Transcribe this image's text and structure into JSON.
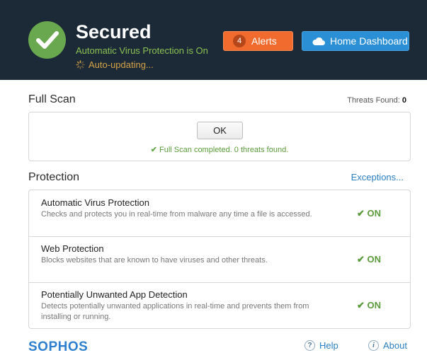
{
  "header": {
    "status_title": "Secured",
    "status_subtitle": "Automatic Virus Protection is On",
    "update_status": "Auto-updating...",
    "alerts": {
      "count": "4",
      "label": "Alerts"
    },
    "dashboard_label": "Home Dashboard"
  },
  "full_scan": {
    "title": "Full Scan",
    "threats_label": "Threats Found:",
    "threats_count": "0",
    "ok_label": "OK",
    "status_message": "Full Scan completed. 0 threats found."
  },
  "protection": {
    "title": "Protection",
    "exceptions_label": "Exceptions...",
    "items": [
      {
        "name": "Automatic Virus Protection",
        "description": "Checks and protects you in real-time from malware any time a file is accessed.",
        "state": "ON"
      },
      {
        "name": "Web Protection",
        "description": "Blocks websites that are known to have viruses and other threats.",
        "state": "ON"
      },
      {
        "name": "Potentially Unwanted App Detection",
        "description": "Detects potentially unwanted applications in real-time and prevents them from installing or running.",
        "state": "ON"
      }
    ]
  },
  "footer": {
    "logo_text": "SOPHOS",
    "help_label": "Help",
    "about_label": "About"
  },
  "colors": {
    "header_bg": "#1b2a36",
    "status_green": "#6aa84f",
    "alerts_orange": "#f26b2e",
    "dashboard_blue": "#2b8fd6",
    "link_blue": "#2b7fc2"
  },
  "icons": [
    "checkmark-icon",
    "spinner-icon",
    "cloud-icon",
    "help-icon",
    "info-icon"
  ]
}
